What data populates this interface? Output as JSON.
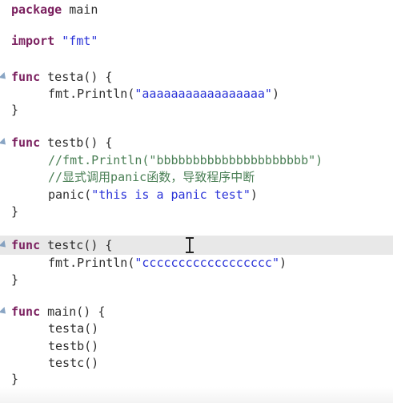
{
  "lines": {
    "l1": {
      "kw": "package",
      "name": "main"
    },
    "l2": {
      "kw": "import",
      "str": "\"fmt\""
    },
    "l3": {
      "kw": "func",
      "sig": "testa() {"
    },
    "l4": {
      "call": "fmt.Println(",
      "str": "\"aaaaaaaaaaaaaaaaa\"",
      "end": ")"
    },
    "l5": {
      "brace": "}"
    },
    "l6": {
      "kw": "func",
      "sig": "testb() {"
    },
    "l7": {
      "comment": "//fmt.Println(\"bbbbbbbbbbbbbbbbbbbbb\")"
    },
    "l8": {
      "comment": "//显式调用panic函数，导致程序中断"
    },
    "l9": {
      "call": "panic(",
      "str": "\"this is a panic test\"",
      "end": ")"
    },
    "l10": {
      "brace": "}"
    },
    "l11": {
      "kw": "func",
      "sig": "testc() {"
    },
    "l12": {
      "call": "fmt.Println(",
      "str": "\"cccccccccccccccccc\"",
      "end": ")"
    },
    "l13": {
      "brace": "}"
    },
    "l14": {
      "kw": "func",
      "sig": "main() {"
    },
    "l15": {
      "call": "testa()"
    },
    "l16": {
      "call": "testb()"
    },
    "l17": {
      "call": "testc()"
    },
    "l18": {
      "brace": "}"
    }
  },
  "colors": {
    "keyword": "#7a1f5e",
    "string": "#2a33d8",
    "comment": "#4a7f55",
    "current_line": "#e8e8e8"
  }
}
